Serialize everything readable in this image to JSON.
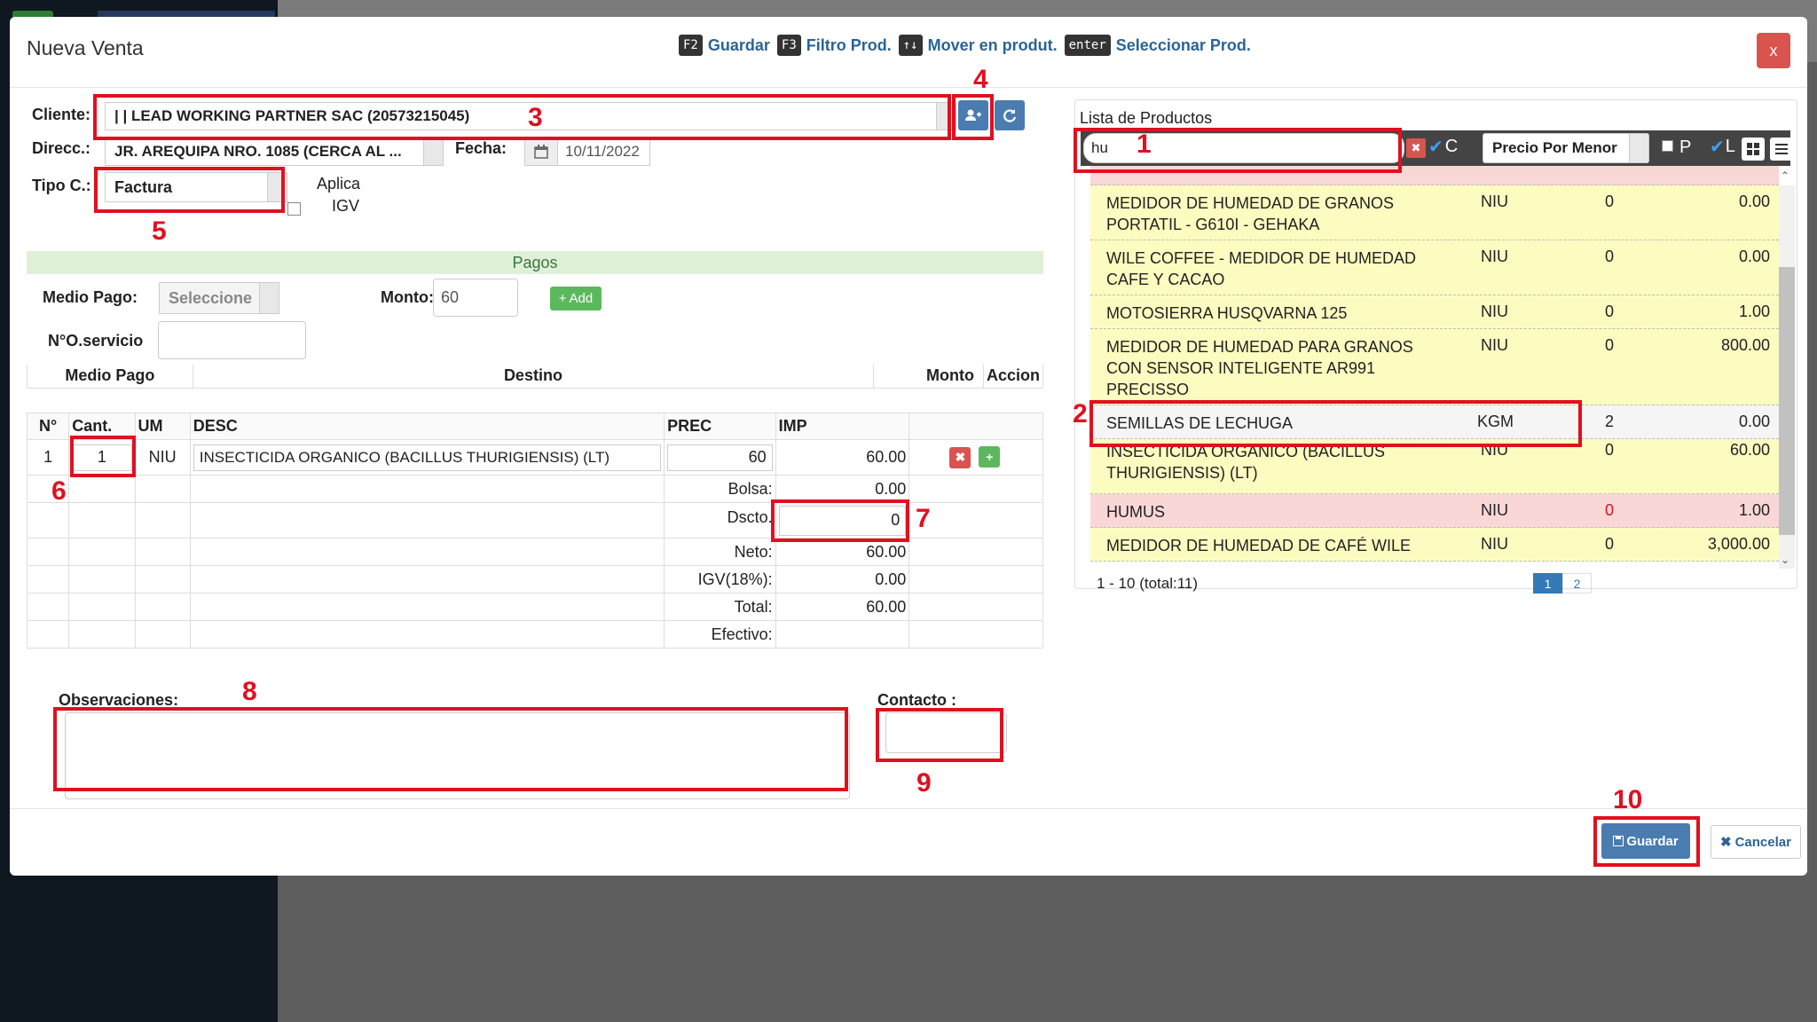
{
  "modal": {
    "title": "Nueva Venta",
    "close_label": "x",
    "shortcuts": [
      {
        "key": "F2",
        "label": "Guardar"
      },
      {
        "key": "F3",
        "label": "Filtro Prod."
      },
      {
        "key": "↑↓",
        "label": "Mover en produt."
      },
      {
        "key": "enter",
        "label": "Seleccionar Prod."
      }
    ]
  },
  "form": {
    "cliente_label": "Cliente:",
    "cliente_value": "| | LEAD WORKING PARTNER SAC (20573215045)",
    "direcc_label": "Direcc.:",
    "direcc_value": "JR. AREQUIPA NRO. 1085 (CERCA AL ...",
    "fecha_label": "Fecha:",
    "fecha_value": "10/11/2022",
    "tipo_label": "Tipo C.:",
    "tipo_value": "Factura",
    "aplica_label": "Aplica",
    "igv_label": "IGV"
  },
  "pagos": {
    "header": "Pagos",
    "medio_label": "Medio Pago:",
    "medio_value": "Seleccione",
    "monto_label": "Monto:",
    "monto_value": "60",
    "add_label": "Add",
    "servicio_label": "N°O.servicio",
    "columns": [
      "Medio Pago",
      "Destino",
      "Monto",
      "Accion"
    ]
  },
  "items": {
    "columns": [
      "N°",
      "Cant.",
      "UM",
      "DESC",
      "PREC",
      "IMP"
    ],
    "rows": [
      {
        "n": "1",
        "cant": "1",
        "um": "NIU",
        "desc": "INSECTICIDA ORGANICO (BACILLUS THURIGIENSIS) (LT)",
        "prec": "60",
        "imp": "60.00"
      }
    ],
    "totals": [
      {
        "label": "Bolsa:",
        "value": "0.00"
      },
      {
        "label": "Dscto.",
        "value": "0"
      },
      {
        "label": "Neto:",
        "value": "60.00"
      },
      {
        "label": "IGV(18%):",
        "value": "0.00"
      },
      {
        "label": "Total:",
        "value": "60.00"
      },
      {
        "label": "Efectivo:",
        "value": ""
      }
    ]
  },
  "notes": {
    "observaciones_label": "Observaciones:",
    "contacto_label": "Contacto :"
  },
  "footer": {
    "guardar_label": "Guardar",
    "cancelar_label": "Cancelar"
  },
  "products": {
    "title": "Lista de Productos",
    "search_value": "hu",
    "c_label": "C",
    "price_mode": "Precio Por Menor",
    "p_label": "P",
    "l_label": "L",
    "rows": [
      {
        "desc": "MEDIDOR DE HUMEDAD DE GRANOS PORTATIL - G610I - GEHAKA",
        "um": "NIU",
        "qty": "0",
        "price": "0.00",
        "color": "#fdfcc0"
      },
      {
        "desc": "WILE COFFEE - MEDIDOR DE HUMEDAD CAFE Y CACAO",
        "um": "NIU",
        "qty": "0",
        "price": "0.00",
        "color": "#fdfcc0"
      },
      {
        "desc": "MOTOSIERRA HUSQVARNA 125",
        "um": "NIU",
        "qty": "0",
        "price": "1.00",
        "color": "#fdfcc0"
      },
      {
        "desc": "MEDIDOR DE HUMEDAD PARA GRANOS CON SENSOR INTELIGENTE AR991 PRECISSO",
        "um": "NIU",
        "qty": "0",
        "price": "800.00",
        "color": "#fdfcc0"
      },
      {
        "desc": "SEMILLAS DE LECHUGA",
        "um": "KGM",
        "qty": "2",
        "price": "0.00",
        "color": "#f5f5f5"
      },
      {
        "desc": "INSECTICIDA ORGANICO (BACILLUS THURIGIENSIS) (LT)",
        "um": "NIU",
        "qty": "0",
        "price": "60.00",
        "color": "#fdfcc0"
      },
      {
        "desc": "HUMUS",
        "um": "NIU",
        "qty": "0",
        "price": "1.00",
        "color": "#fad7d7"
      },
      {
        "desc": "MEDIDOR DE HUMEDAD DE CAFÉ WILE",
        "um": "NIU",
        "qty": "0",
        "price": "3,000.00",
        "color": "#fdfcc0"
      }
    ],
    "range_text": "1 - 10 (total:11)",
    "pages": [
      "1",
      "2"
    ]
  },
  "annotations": [
    "1",
    "2",
    "3",
    "4",
    "5",
    "6",
    "7",
    "8",
    "9",
    "10"
  ]
}
